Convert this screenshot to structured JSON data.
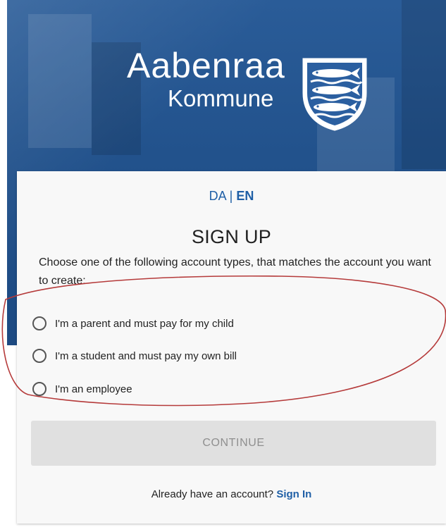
{
  "brand": {
    "name": "Aabenraa",
    "subtitle": "Kommune",
    "logo": "aabenraa-herring-shield"
  },
  "language": {
    "da": "DA",
    "separator": "|",
    "en": "EN",
    "active": "EN"
  },
  "signup": {
    "title": "SIGN UP",
    "intro": "Choose one of the following account types, that matches the account you want to create:",
    "options": [
      {
        "label": "I'm a parent and must pay for my child",
        "selected": false
      },
      {
        "label": "I'm a student and must pay my own bill",
        "selected": false
      },
      {
        "label": "I'm an employee",
        "selected": false
      }
    ],
    "continue_label": "CONTINUE",
    "continue_enabled": false,
    "signin_prompt": "Already have an account?",
    "signin_link": "Sign In"
  },
  "colors": {
    "hero_blue": "#22528c",
    "link_blue": "#1f5fa6",
    "annotation_red": "#b53a3a",
    "disabled_button": "#e0e0e0"
  }
}
